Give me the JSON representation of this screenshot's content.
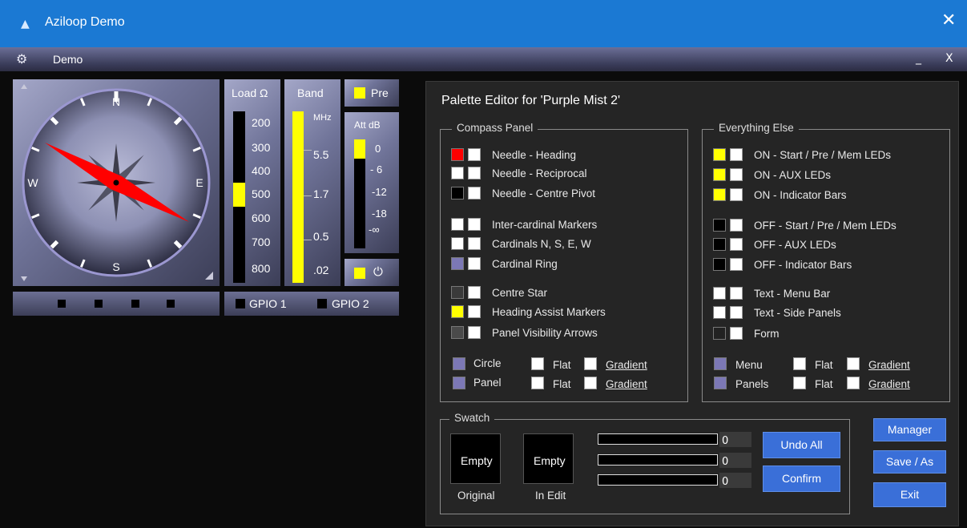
{
  "window": {
    "title": "Aziloop Demo",
    "close_glyph": "✕"
  },
  "menubar": {
    "label": "Demo",
    "minimize_glyph": "_",
    "close_glyph": "X"
  },
  "compass": {
    "north": "N",
    "south": "S",
    "east": "E",
    "west": "W",
    "heading_deg": 300
  },
  "leds_bottom": [
    "■",
    "■",
    "■",
    "■"
  ],
  "load": {
    "title": "Load Ω",
    "values": [
      "200",
      "300",
      "400",
      "500",
      "600",
      "700",
      "800"
    ],
    "selected": "500"
  },
  "band": {
    "title": "Band",
    "unit": "MHz",
    "values": [
      "5.5",
      "1.7",
      "0.5",
      ".02"
    ]
  },
  "pre": {
    "label": "Pre"
  },
  "att": {
    "title": "Att dB",
    "values": [
      "0",
      "- 6",
      "-12",
      "-18",
      "-∞"
    ]
  },
  "gpio": {
    "gpio1": "GPIO 1",
    "gpio2": "GPIO 2"
  },
  "palette": {
    "title": "Palette Editor for 'Purple Mist 2'",
    "compass_group": {
      "title": "Compass Panel",
      "items": [
        {
          "label": "Needle - Heading",
          "color": "#ff0000"
        },
        {
          "label": "Needle - Reciprocal",
          "color": "#ffffff"
        },
        {
          "label": "Needle - Centre Pivot",
          "color": "#000000"
        },
        {
          "label": "Inter-cardinal Markers",
          "color": "#ffffff"
        },
        {
          "label": "Cardinals N, S, E, W",
          "color": "#ffffff"
        },
        {
          "label": "Cardinal Ring",
          "color": "#7c78b5"
        },
        {
          "label": "Centre Star",
          "color": "#3a3a3a"
        },
        {
          "label": "Heading Assist Markers",
          "color": "#ffff00"
        },
        {
          "label": "Panel Visibility Arrows",
          "color": "#4a4a4a"
        }
      ],
      "circle": "Circle",
      "panel": "Panel",
      "flat": "Flat",
      "gradient": "Gradient",
      "circle_color": "#7c78b5",
      "panel_color": "#7c78b5"
    },
    "else_group": {
      "title": "Everything Else",
      "items": [
        {
          "label": "ON - Start / Pre / Mem LEDs",
          "color": "#ffff00"
        },
        {
          "label": "ON - AUX LEDs",
          "color": "#ffff00"
        },
        {
          "label": "ON - Indicator Bars",
          "color": "#ffff00"
        },
        {
          "label": "OFF - Start / Pre / Mem LEDs",
          "color": "#000000"
        },
        {
          "label": "OFF - AUX LEDs",
          "color": "#000000"
        },
        {
          "label": "OFF - Indicator Bars",
          "color": "#000000"
        },
        {
          "label": "Text - Menu Bar",
          "color": "#ffffff"
        },
        {
          "label": "Text - Side Panels",
          "color": "#ffffff"
        },
        {
          "label": "Form",
          "color": "#222222"
        }
      ],
      "menu": "Menu",
      "panels": "Panels",
      "flat": "Flat",
      "gradient": "Gradient",
      "menu_color": "#7c78b5",
      "panels_color": "#7c78b5"
    },
    "swatch": {
      "title": "Swatch",
      "original_box": "Empty",
      "original_label": "Original",
      "edit_box": "Empty",
      "edit_label": "In Edit",
      "values": [
        "0",
        "0",
        "0"
      ]
    },
    "buttons": {
      "undo": "Undo All",
      "confirm": "Confirm",
      "manager": "Manager",
      "save": "Save / As",
      "exit": "Exit"
    }
  }
}
